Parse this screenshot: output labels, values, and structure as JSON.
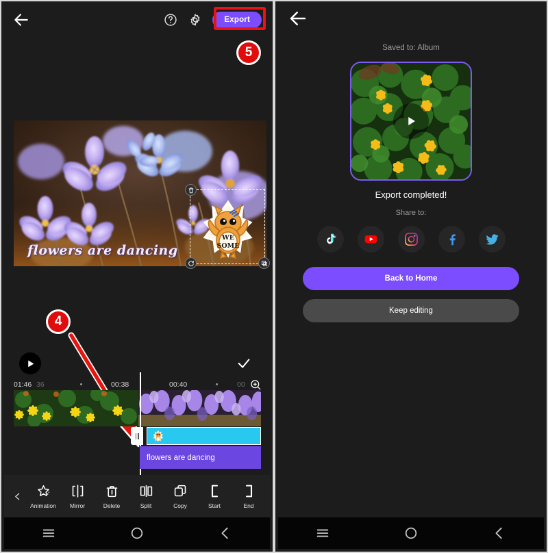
{
  "left_phone": {
    "topbar": {
      "back_icon": "back-arrow-icon",
      "help_icon": "help-circle-icon",
      "settings_icon": "gear-icon",
      "export_label": "Export"
    },
    "badges": [
      {
        "label": "5"
      },
      {
        "label": "4"
      }
    ],
    "preview": {
      "caption_text": "flowers are dancing",
      "sticker_text_line1": "WE",
      "sticker_text_line2": "SOME",
      "delete_handle_icon": "trash-icon",
      "rotate_handle_icon": "rotate-icon",
      "resize_handle_icon": "resize-icon"
    },
    "play_row": {
      "play_icon": "play-icon",
      "confirm_icon": "check-icon"
    },
    "ruler": {
      "ticks": [
        {
          "label": "01:46",
          "dim": false
        },
        {
          "label": "36",
          "dim": true
        },
        {
          "label": "00:38",
          "dim": false
        },
        {
          "label": "00:40",
          "dim": false
        },
        {
          "label": "00",
          "dim": true
        }
      ],
      "zoom_icon": "zoom-in-icon"
    },
    "tracks": {
      "sticker_track_label": "",
      "text_track_label": "flowers are dancing"
    },
    "toolbar": {
      "prev_icon": "chevron-left-icon",
      "items": [
        {
          "label": "Animation",
          "icon": "star-sparkle-icon"
        },
        {
          "label": "Mirror",
          "icon": "mirror-icon"
        },
        {
          "label": "Delete",
          "icon": "trash-icon"
        },
        {
          "label": "Split",
          "icon": "split-icon"
        },
        {
          "label": "Copy",
          "icon": "copy-icon"
        },
        {
          "label": "Start",
          "icon": "bracket-left-icon"
        },
        {
          "label": "End",
          "icon": "bracket-right-icon"
        }
      ]
    },
    "navbar": {
      "menu_icon": "menu-icon",
      "home_icon": "home-circle-icon",
      "back_icon": "back-chevron-icon"
    }
  },
  "right_phone": {
    "back_icon": "back-arrow-icon",
    "saved_to": "Saved to: Album",
    "thumb_play_icon": "play-icon",
    "export_completed": "Export completed!",
    "share_to": "Share to:",
    "share_icons": [
      {
        "name": "tiktok-icon"
      },
      {
        "name": "youtube-icon"
      },
      {
        "name": "instagram-icon"
      },
      {
        "name": "facebook-icon"
      },
      {
        "name": "twitter-icon"
      }
    ],
    "back_home_label": "Back to Home",
    "keep_editing_label": "Keep editing",
    "navbar": {
      "menu_icon": "menu-icon",
      "home_icon": "home-circle-icon",
      "back_icon": "back-chevron-icon"
    }
  },
  "colors": {
    "accent_purple": "#7c4dff",
    "badge_red": "#e10d0d",
    "highlight_red": "#ee1111",
    "sticker_track_cyan": "#28c8f0",
    "text_track_purple": "#6c46e0",
    "panel_dark": "#1c1c1c"
  }
}
